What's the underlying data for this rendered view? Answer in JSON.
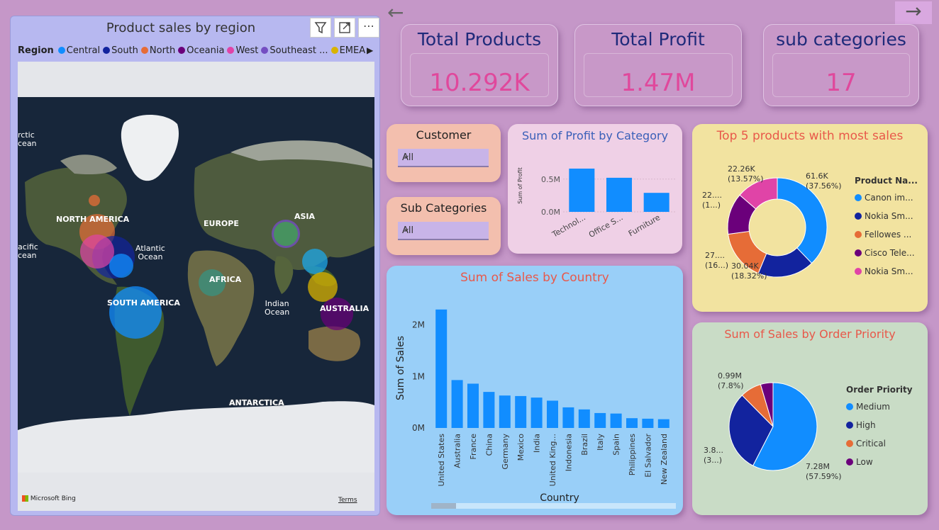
{
  "nav": {
    "back_glyph": "←",
    "forward_glyph": "→"
  },
  "map": {
    "title": "Product sales by region",
    "legend_title": "Region",
    "legend": [
      {
        "label": "Central",
        "color": "#118dff"
      },
      {
        "label": "South",
        "color": "#12239e"
      },
      {
        "label": "North",
        "color": "#e66c37"
      },
      {
        "label": "Oceania",
        "color": "#6b007b"
      },
      {
        "label": "West",
        "color": "#e044a7"
      },
      {
        "label": "Southeast ...",
        "color": "#744ec2"
      },
      {
        "label": "EMEA",
        "color": "#d9b300"
      }
    ],
    "labels": {
      "arctic1": "rctic",
      "arctic2": "cean",
      "pacific1": "acific",
      "pacific2": "cean",
      "north_america": "NORTH AMERICA",
      "europe": "EUROPE",
      "asia": "ASIA",
      "atlantic1": "Atlantic",
      "atlantic2": "Ocean",
      "africa": "AFRICA",
      "indian1": "Indian",
      "indian2": "Ocean",
      "south_america": "SOUTH AMERICA",
      "australia": "AUSTRALIA",
      "antarctica": "ANTARCTICA"
    },
    "bing": "Microsoft Bing",
    "terms": "Terms"
  },
  "kpis": [
    {
      "title": "Total Products",
      "value": "10.292K"
    },
    {
      "title": "Total Profit",
      "value": "1.47M"
    },
    {
      "title": "sub categories",
      "value": "17"
    }
  ],
  "slicers": {
    "customer": {
      "title": "Customer",
      "value": "All"
    },
    "subcat": {
      "title": "Sub Categories",
      "value": "All"
    }
  },
  "chart_data": [
    {
      "id": "profit_by_category",
      "type": "bar",
      "title": "Sum of Profit by Category",
      "ylabel": "Sum of Profit",
      "xlabel": "",
      "categories": [
        "Technol...",
        "Office S...",
        "Furniture"
      ],
      "values": [
        0.66,
        0.52,
        0.29
      ],
      "yticks": [
        "0.0M",
        "0.5M"
      ],
      "ylim": [
        0,
        0.8
      ],
      "color": "#118dff"
    },
    {
      "id": "sales_by_country",
      "type": "bar",
      "title": "Sum of Sales by Country",
      "ylabel": "Sum of Sales",
      "xlabel": "Country",
      "categories": [
        "United States",
        "Australia",
        "France",
        "China",
        "Germany",
        "Mexico",
        "India",
        "United King...",
        "Indonesia",
        "Brazil",
        "Italy",
        "Spain",
        "Philippines",
        "El Salvador",
        "New Zealand"
      ],
      "values": [
        2.3,
        0.93,
        0.86,
        0.7,
        0.63,
        0.62,
        0.59,
        0.53,
        0.4,
        0.36,
        0.29,
        0.28,
        0.19,
        0.18,
        0.17
      ],
      "yticks": [
        "0M",
        "1M",
        "2M"
      ],
      "ylim": [
        0,
        2.6
      ],
      "color": "#118dff"
    },
    {
      "id": "top5_products",
      "type": "pie",
      "title": "Top 5 products with most sales",
      "legend_title": "Product Na...",
      "slices": [
        {
          "label": "Canon im...",
          "value": 61.6,
          "color": "#118dff"
        },
        {
          "label": "Nokia Sm...",
          "value": 30.04,
          "color": "#12239e"
        },
        {
          "label": "Fellowes ...",
          "value": 27.0,
          "color": "#e66c37"
        },
        {
          "label": "Cisco Tele...",
          "value": 22.0,
          "color": "#6b007b"
        },
        {
          "label": "Nokia Sm...",
          "value": 22.26,
          "color": "#e044a7"
        }
      ],
      "data_labels": [
        {
          "l1": "61.6K",
          "l2": "(37.56%)"
        },
        {
          "l1": "30.04K",
          "l2": "(18.32%)"
        },
        {
          "l1": "27....",
          "l2": "(16...)"
        },
        {
          "l1": "22....",
          "l2": "(1...)"
        },
        {
          "l1": "22.26K",
          "l2": "(13.57%)"
        }
      ]
    },
    {
      "id": "sales_by_priority",
      "type": "pie",
      "title": "Sum of Sales by Order Priority",
      "legend_title": "Order Priority",
      "slices": [
        {
          "label": "Medium",
          "value": 7.28,
          "color": "#118dff"
        },
        {
          "label": "High",
          "value": 3.8,
          "color": "#12239e"
        },
        {
          "label": "Critical",
          "value": 0.99,
          "color": "#e66c37"
        },
        {
          "label": "Low",
          "value": 0.58,
          "color": "#6b007b"
        }
      ],
      "data_labels": [
        {
          "l1": "7.28M",
          "l2": "(57.59%)"
        },
        {
          "l1": "3.8...",
          "l2": "(3...)"
        },
        {
          "l1": "0.99M",
          "l2": "(7.8%)"
        }
      ]
    }
  ]
}
